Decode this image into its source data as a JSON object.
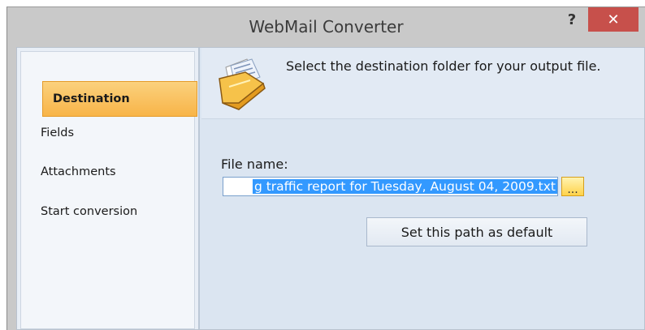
{
  "window": {
    "title": "WebMail Converter",
    "help_label": "?",
    "close_label": "✕"
  },
  "sidebar": {
    "items": [
      {
        "label": "Destination",
        "active": true
      },
      {
        "label": "Fields",
        "active": false
      },
      {
        "label": "Attachments",
        "active": false
      },
      {
        "label": "Start conversion",
        "active": false
      }
    ]
  },
  "header": {
    "text": "Select the destination folder for your output file.",
    "icon": "folder-icon"
  },
  "form": {
    "file_label": "File name:",
    "file_value": "g traffic report for Tuesday, August 04, 2009.txt",
    "browse_label": "...",
    "default_button_label": "Set this path as default"
  },
  "colors": {
    "active_tab": "#f8b448",
    "selection": "#3399ff",
    "close_button": "#c7504b"
  }
}
